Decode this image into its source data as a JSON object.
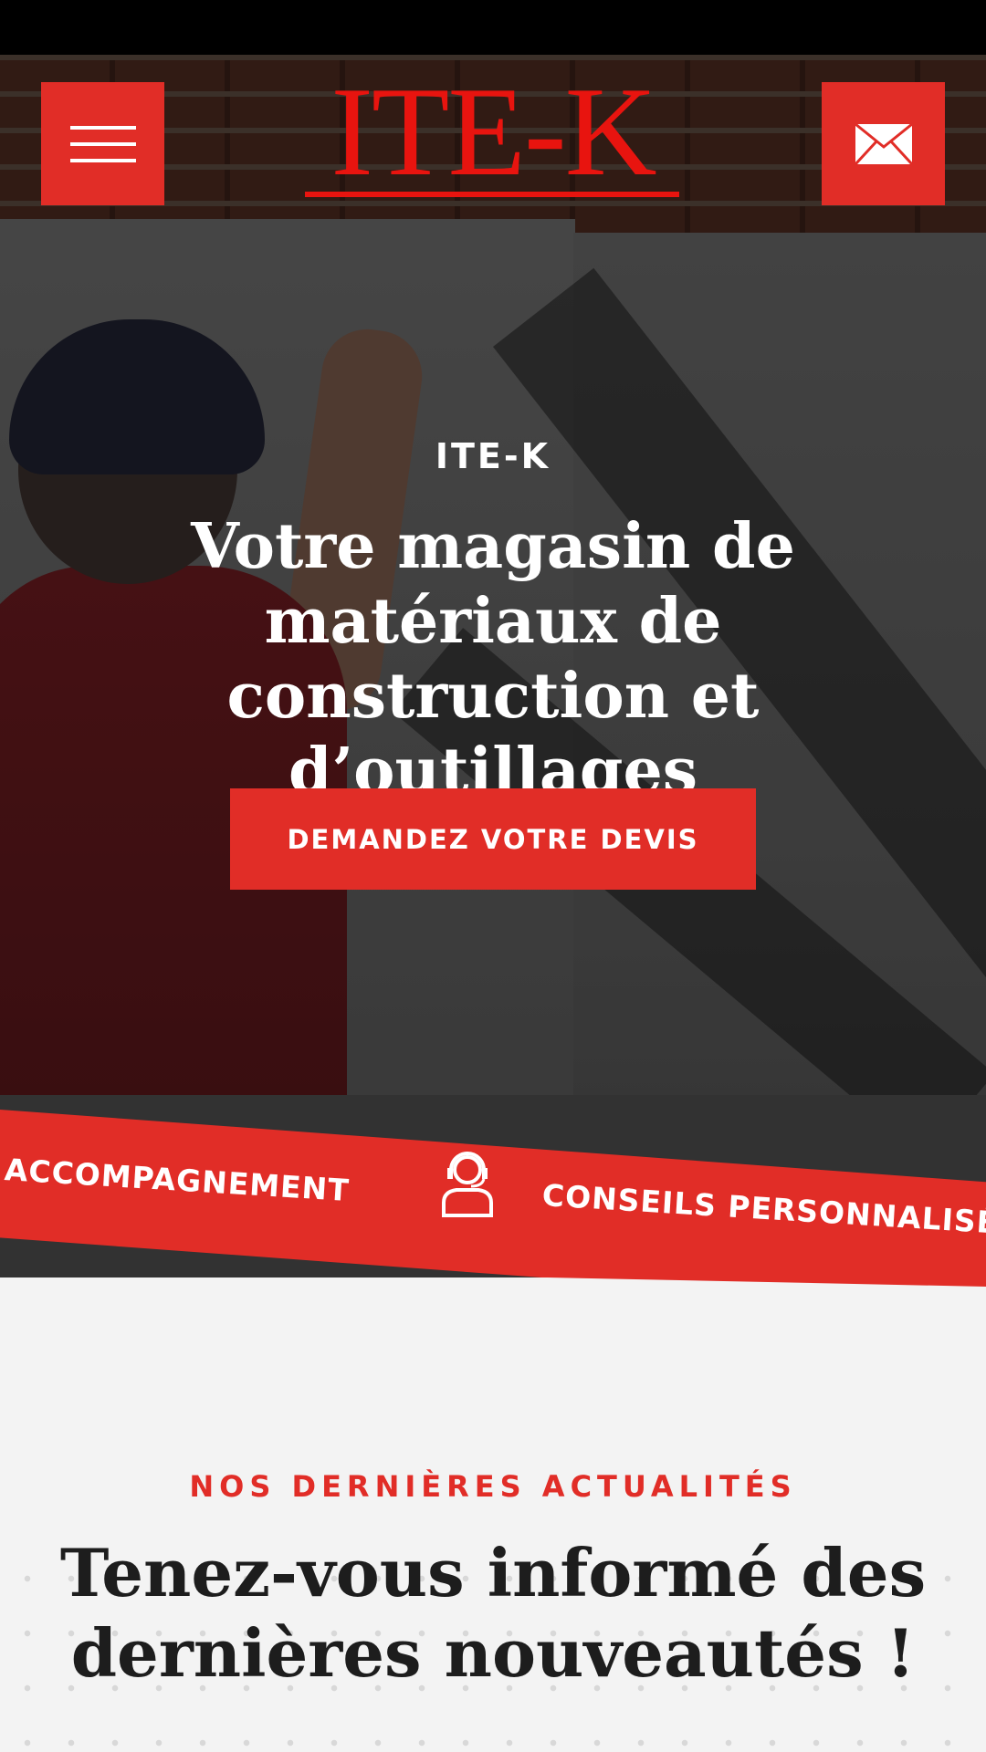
{
  "header": {
    "logo_text": "ITE-K",
    "menu_icon": "hamburger-menu-icon",
    "mail_icon": "envelope-icon"
  },
  "hero": {
    "eyebrow": "ITE-K",
    "title": "Votre magasin de matériaux de construction et d’outillages professionnels",
    "cta_label": "DEMANDEZ VOTRE DEVIS"
  },
  "band": {
    "item_1": "ACCOMPAGNEMENT",
    "item_2": "CONSEILS PERSONNALISÉS",
    "icon": "customer-support-icon"
  },
  "news": {
    "eyebrow": "NOS DERNIÈRES ACTUALITÉS",
    "title": "Tenez-vous informé des dernières nouveautés !"
  },
  "colors": {
    "accent": "#e12d27",
    "logo": "#e8140f",
    "dark": "#323232",
    "light_bg": "#f3f3f3"
  }
}
